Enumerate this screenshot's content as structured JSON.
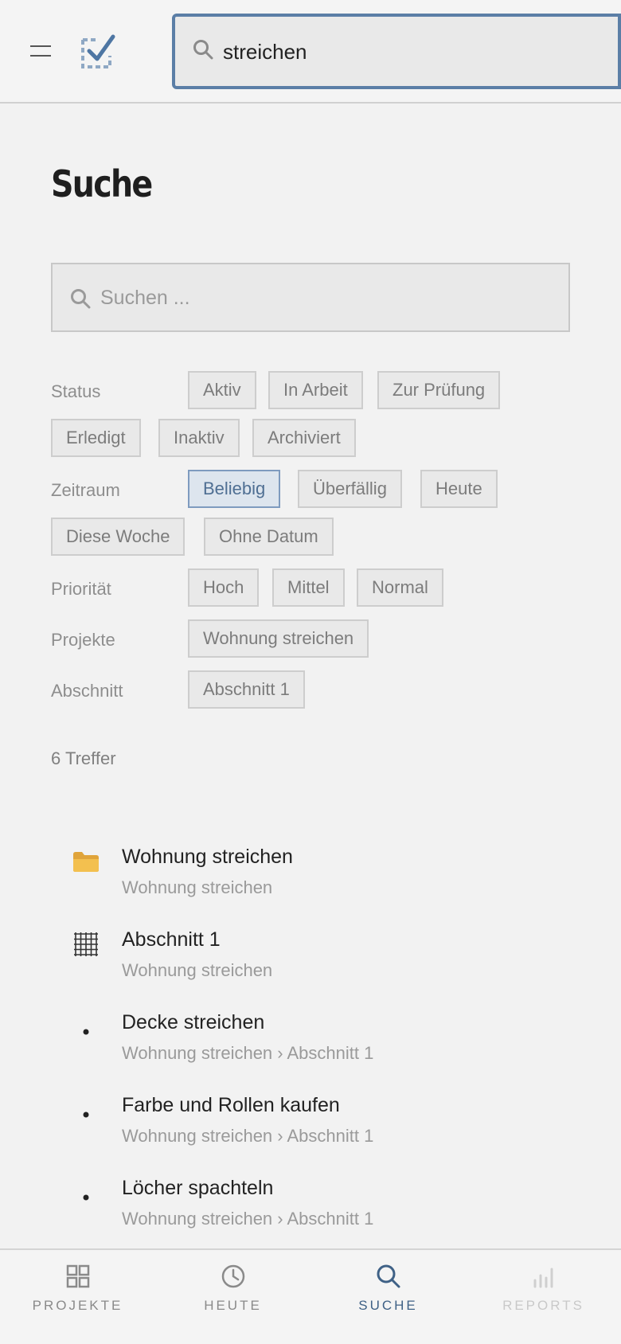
{
  "top_search": {
    "value": "streichen"
  },
  "page_title": "Suche",
  "search": {
    "placeholder": "Suchen ..."
  },
  "filters": {
    "status": {
      "label": "Status",
      "chips": [
        "Aktiv",
        "In Arbeit",
        "Zur Prüfung",
        "Erledigt",
        "Inaktiv",
        "Archiviert"
      ]
    },
    "zeitraum": {
      "label": "Zeitraum",
      "chips": [
        "Beliebig",
        "Überfällig",
        "Heute",
        "Diese Woche",
        "Ohne Datum"
      ],
      "active": "Beliebig"
    },
    "prioritaet": {
      "label": "Priorität",
      "chips": [
        "Hoch",
        "Mittel",
        "Normal"
      ]
    },
    "projekte": {
      "label": "Projekte",
      "chips": [
        "Wohnung streichen"
      ]
    },
    "abschnitt": {
      "label": "Abschnitt",
      "chips": [
        "Abschnitt 1"
      ]
    }
  },
  "hit_count": "6 Treffer",
  "results": [
    {
      "icon": "folder-icon",
      "title": "Wohnung streichen",
      "subtitle": "Wohnung streichen"
    },
    {
      "icon": "grid-icon",
      "title": "Abschnitt 1",
      "subtitle": "Wohnung streichen"
    },
    {
      "icon": "bullet-icon",
      "title": "Decke streichen",
      "subtitle": "Wohnung streichen › Abschnitt 1"
    },
    {
      "icon": "bullet-icon",
      "title": "Farbe und Rollen kaufen",
      "subtitle": "Wohnung streichen › Abschnitt 1"
    },
    {
      "icon": "bullet-icon",
      "title": "Löcher spachteln",
      "subtitle": "Wohnung streichen › Abschnitt 1"
    }
  ],
  "nav": [
    {
      "label": "PROJEKTE",
      "icon": "grid-icon",
      "state": "normal"
    },
    {
      "label": "HEUTE",
      "icon": "clock-icon",
      "state": "normal"
    },
    {
      "label": "SUCHE",
      "icon": "search-icon",
      "state": "active"
    },
    {
      "label": "REPORTS",
      "icon": "bar-chart-icon",
      "state": "disabled"
    }
  ],
  "colors": {
    "accent": "#5b7ea6",
    "active_nav": "#3f6186",
    "background": "#f2f2f2"
  }
}
